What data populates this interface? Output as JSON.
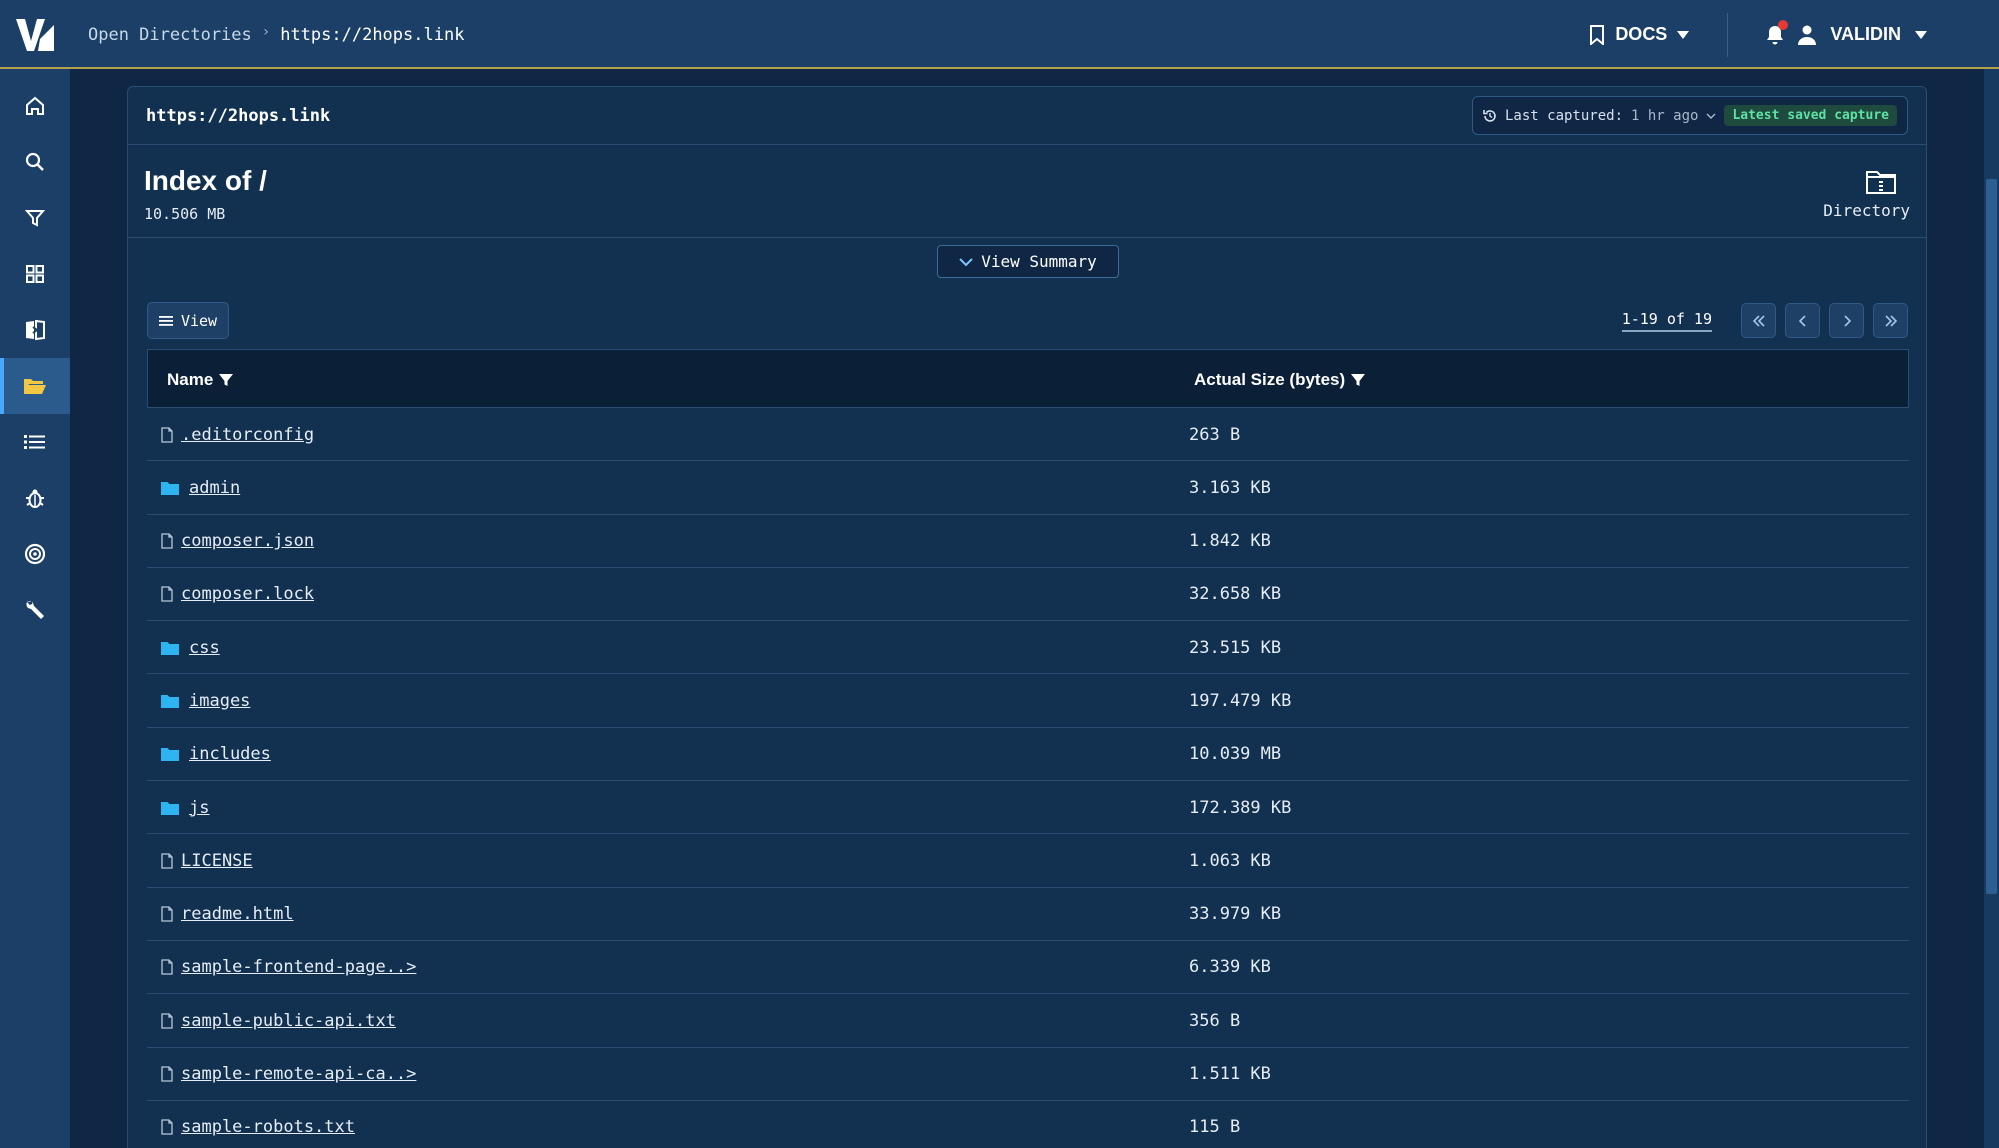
{
  "header": {
    "logo_text": "V",
    "breadcrumb": [
      {
        "label": "Open Directories"
      },
      {
        "label": "https://2hops.link"
      }
    ],
    "docs_label": "DOCS",
    "user_label": "VALIDIN",
    "notification_dot_color": "#e53935"
  },
  "sidebar": {
    "items": [
      {
        "name": "home-icon"
      },
      {
        "name": "search-icon"
      },
      {
        "name": "filter-icon"
      },
      {
        "name": "grid-icon"
      },
      {
        "name": "compare-icon"
      },
      {
        "name": "folder-open-icon",
        "active": true
      },
      {
        "name": "list-icon"
      },
      {
        "name": "bug-icon"
      },
      {
        "name": "target-icon"
      },
      {
        "name": "wrench-icon"
      }
    ]
  },
  "panel": {
    "url": "https://2hops.link",
    "capture_prefix": "Last captured:",
    "capture_time": "1 hr ago",
    "capture_badge": "Latest saved capture",
    "title": "Index of /",
    "total_size": "10.506 MB",
    "type_label": "Directory",
    "view_summary_label": "View Summary",
    "view_button_label": "View",
    "pager_text": "1-19 of 19"
  },
  "table": {
    "columns": [
      "Name",
      "Actual Size (bytes)"
    ],
    "rows": [
      {
        "name": ".editorconfig",
        "size": "263 B",
        "type": "file"
      },
      {
        "name": "admin",
        "size": "3.163 KB",
        "type": "folder"
      },
      {
        "name": "composer.json",
        "size": "1.842 KB",
        "type": "file"
      },
      {
        "name": "composer.lock",
        "size": "32.658 KB",
        "type": "file"
      },
      {
        "name": "css",
        "size": "23.515 KB",
        "type": "folder"
      },
      {
        "name": "images",
        "size": "197.479 KB",
        "type": "folder"
      },
      {
        "name": "includes",
        "size": "10.039 MB",
        "type": "folder"
      },
      {
        "name": "js",
        "size": "172.389 KB",
        "type": "folder"
      },
      {
        "name": "LICENSE",
        "size": "1.063 KB",
        "type": "file"
      },
      {
        "name": "readme.html",
        "size": "33.979 KB",
        "type": "file"
      },
      {
        "name": "sample-frontend-page..>",
        "size": "6.339 KB",
        "type": "file"
      },
      {
        "name": "sample-public-api.txt",
        "size": "356 B",
        "type": "file"
      },
      {
        "name": "sample-remote-api-ca..>",
        "size": "1.511 KB",
        "type": "file"
      },
      {
        "name": "sample-robots.txt",
        "size": "115 B",
        "type": "file"
      }
    ]
  },
  "colors": {
    "background": "#0f2744",
    "topbar": "#1b3f66",
    "folder": "#2fb4f2",
    "badge_text": "#5fe0a5"
  }
}
